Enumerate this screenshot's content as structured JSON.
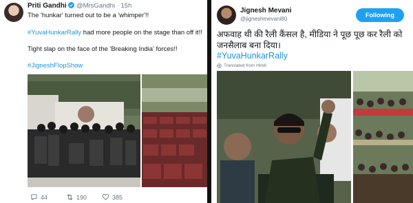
{
  "left_tweet": {
    "author_name": "Priti Gandhi",
    "verified_icon": "verified-badge-icon",
    "handle": "@MrsGandhi",
    "separator": "·",
    "time": "15h",
    "line1": "The 'hunkar' turned out to be a 'whimper'!!",
    "line2_tag": "#YuvaHunkarRally",
    "line2_rest": " had more people on the stage than off it!!",
    "line3": "Tight slap on the face of the 'Breaking India' forces!!",
    "line4_tag": "#JigneshFlopShow",
    "replies": "44",
    "retweets": "190",
    "likes": "385"
  },
  "right_tweet": {
    "author_name": "Jignesh Mevani",
    "handle": "@jigneshmevani80",
    "follow_label": "Following",
    "text": "अफवाह थी की रैली कैंसल है, मीडिया ने पूछ पूछ कर रैली को जनसैलाब बना दिया।",
    "hashtag": "#YuvaHunkarRally",
    "translated_label": "Translated from Hindi"
  },
  "colors": {
    "link": "#1b95e0",
    "button": "#1da1f2",
    "muted": "#657786",
    "divider": "#111111"
  }
}
